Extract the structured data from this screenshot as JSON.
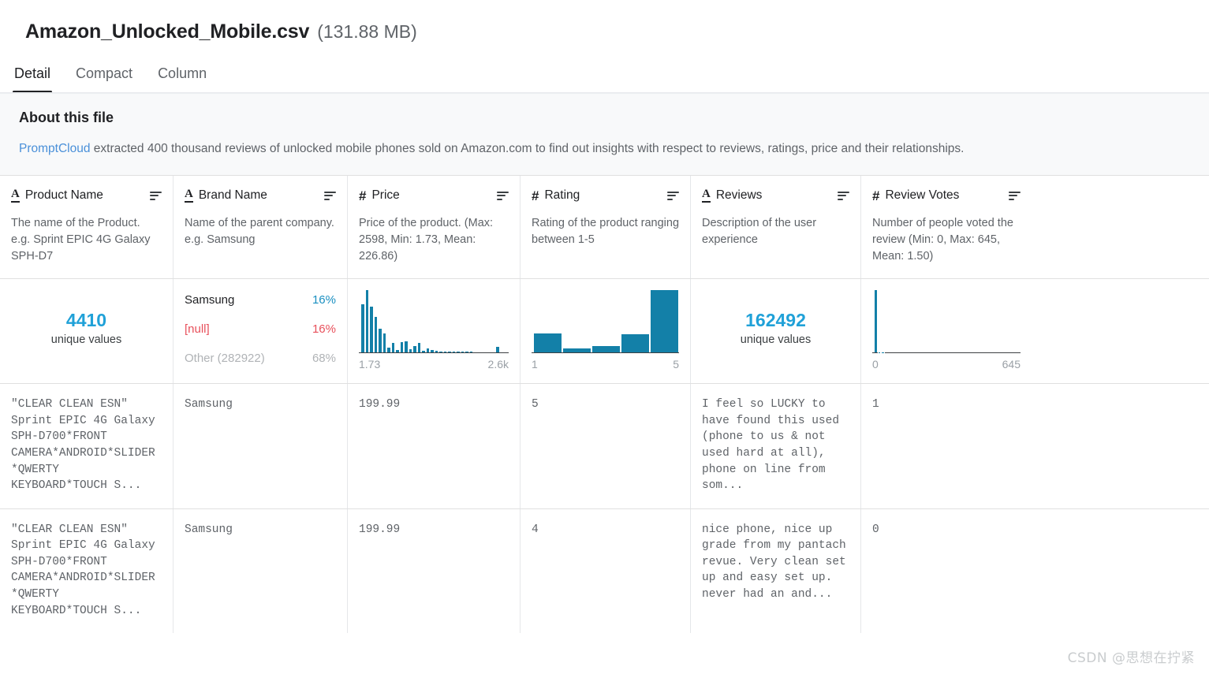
{
  "file": {
    "name": "Amazon_Unlocked_Mobile.csv",
    "size": "(131.88 MB)"
  },
  "tabs": [
    {
      "label": "Detail",
      "active": true
    },
    {
      "label": "Compact",
      "active": false
    },
    {
      "label": "Column",
      "active": false
    }
  ],
  "about": {
    "title": "About this file",
    "link_text": "PromptCloud",
    "body": " extracted 400 thousand reviews of unlocked mobile phones sold on Amazon.com to find out insights with respect to reviews, ratings, price and their relationships."
  },
  "columns": [
    {
      "name": "Product Name",
      "type_icon": "string-type-icon",
      "type_glyph": "A",
      "description": "The name of the Product. e.g. Sprint EPIC 4G Galaxy SPH-D7",
      "stat_kind": "unique",
      "unique_count": "4410",
      "unique_label": "unique values"
    },
    {
      "name": "Brand Name",
      "type_icon": "string-type-icon",
      "type_glyph": "A",
      "description": "Name of the parent company. e.g. Samsung",
      "stat_kind": "frequency",
      "frequencies": [
        {
          "label": "Samsung",
          "pct": "16%",
          "style": "normal"
        },
        {
          "label": "[null]",
          "pct": "16%",
          "style": "null"
        },
        {
          "label": "Other (282922)",
          "pct": "68%",
          "style": "other"
        }
      ]
    },
    {
      "name": "Price",
      "type_icon": "number-type-icon",
      "type_glyph": "#",
      "description": "Price of the product. (Max: 2598, Min: 1.73, Mean: 226.86)",
      "stat_kind": "histogram",
      "axis_min": "1.73",
      "axis_max": "2.6k"
    },
    {
      "name": "Rating",
      "type_icon": "number-type-icon",
      "type_glyph": "#",
      "description": "Rating of the product ranging between 1-5",
      "stat_kind": "histogram",
      "axis_min": "1",
      "axis_max": "5"
    },
    {
      "name": "Reviews",
      "type_icon": "string-type-icon",
      "type_glyph": "A",
      "description": "Description of the user experience",
      "stat_kind": "unique",
      "unique_count": "162492",
      "unique_label": "unique values"
    },
    {
      "name": "Review Votes",
      "type_icon": "number-type-icon",
      "type_glyph": "#",
      "description": "Number of people voted the review (Min: 0, Max: 645, Mean: 1.50)",
      "stat_kind": "histogram",
      "axis_min": "0",
      "axis_max": "645"
    }
  ],
  "rows": [
    {
      "product_name": "\"CLEAR CLEAN ESN\" Sprint EPIC 4G Galaxy SPH-D700*FRONT CAMERA*ANDROID*SLIDER*QWERTY KEYBOARD*TOUCH S...",
      "brand_name": "Samsung",
      "price": "199.99",
      "rating": "5",
      "reviews": "I feel so LUCKY to have found this used (phone to us & not used hard at all), phone on line from som...",
      "review_votes": "1"
    },
    {
      "product_name": "\"CLEAR CLEAN ESN\" Sprint EPIC 4G Galaxy SPH-D700*FRONT CAMERA*ANDROID*SLIDER*QWERTY KEYBOARD*TOUCH S...",
      "brand_name": "Samsung",
      "price": "199.99",
      "rating": "4",
      "reviews": "nice phone, nice up grade from my pantach revue. Very clean set up and easy set up. never had an and...",
      "review_votes": "0"
    }
  ],
  "watermark": "CSDN @思想在拧紧",
  "colors": {
    "accent_blue": "#20a1d8",
    "bar_blue": "#1380a8",
    "null_red": "#e8505b",
    "other_gray": "#b0b3b6",
    "link_blue": "#4a90d9"
  },
  "chart_data": [
    {
      "type": "bar",
      "title": "Price",
      "xlabel": "",
      "ylabel": "",
      "x_range": [
        1.73,
        2598
      ],
      "tick_labels": [
        "1.73",
        "2.6k"
      ],
      "grid": false,
      "legend": "none",
      "categories": [
        "b1",
        "b2",
        "b3",
        "b4",
        "b5",
        "b6",
        "b7",
        "b8",
        "b9",
        "b10",
        "b11",
        "b12",
        "b13",
        "b14",
        "b15",
        "b16",
        "b17",
        "b18",
        "b19",
        "b20",
        "b21",
        "b22",
        "b23",
        "b24",
        "b25",
        "b26",
        "b27",
        "b28",
        "b29",
        "b30",
        "b31",
        "b32",
        "b33",
        "b34"
      ],
      "values": [
        78,
        100,
        74,
        57,
        38,
        31,
        8,
        16,
        4,
        17,
        18,
        5,
        11,
        15,
        3,
        7,
        4,
        3,
        2,
        2,
        1,
        1,
        1,
        1,
        1,
        1,
        0,
        0,
        0,
        0,
        0,
        9,
        0,
        0
      ]
    },
    {
      "type": "bar",
      "title": "Rating",
      "xlabel": "",
      "ylabel": "",
      "x_range": [
        1,
        5
      ],
      "tick_labels": [
        "1",
        "5"
      ],
      "grid": false,
      "legend": "none",
      "categories": [
        "1",
        "2",
        "3",
        "4",
        "5"
      ],
      "values": [
        31,
        6,
        11,
        30,
        100
      ]
    },
    {
      "type": "bar",
      "title": "Review Votes",
      "xlabel": "",
      "ylabel": "",
      "x_range": [
        0,
        645
      ],
      "tick_labels": [
        "0",
        "645"
      ],
      "grid": false,
      "legend": "none",
      "categories": [
        "0",
        "1",
        "2",
        "3",
        "4",
        "5",
        "6",
        "7",
        "8",
        "9",
        "10",
        "11",
        "12",
        "13",
        "14",
        "15",
        "16",
        "17",
        "18",
        "19",
        "20",
        "21",
        "22",
        "23",
        "24",
        "25",
        "26",
        "27",
        "28",
        "29",
        "30",
        "31",
        "32",
        "33",
        "34",
        "35",
        "36",
        "37",
        "38",
        "39"
      ],
      "values": [
        100,
        0.6,
        0.3,
        0,
        0,
        0,
        0,
        0,
        0,
        0,
        0,
        0,
        0,
        0,
        0,
        0,
        0,
        0,
        0,
        0,
        0,
        0,
        0,
        0,
        0,
        0,
        0,
        0,
        0,
        0,
        0,
        0,
        0,
        0,
        0,
        0,
        0,
        0,
        0,
        0
      ]
    }
  ]
}
